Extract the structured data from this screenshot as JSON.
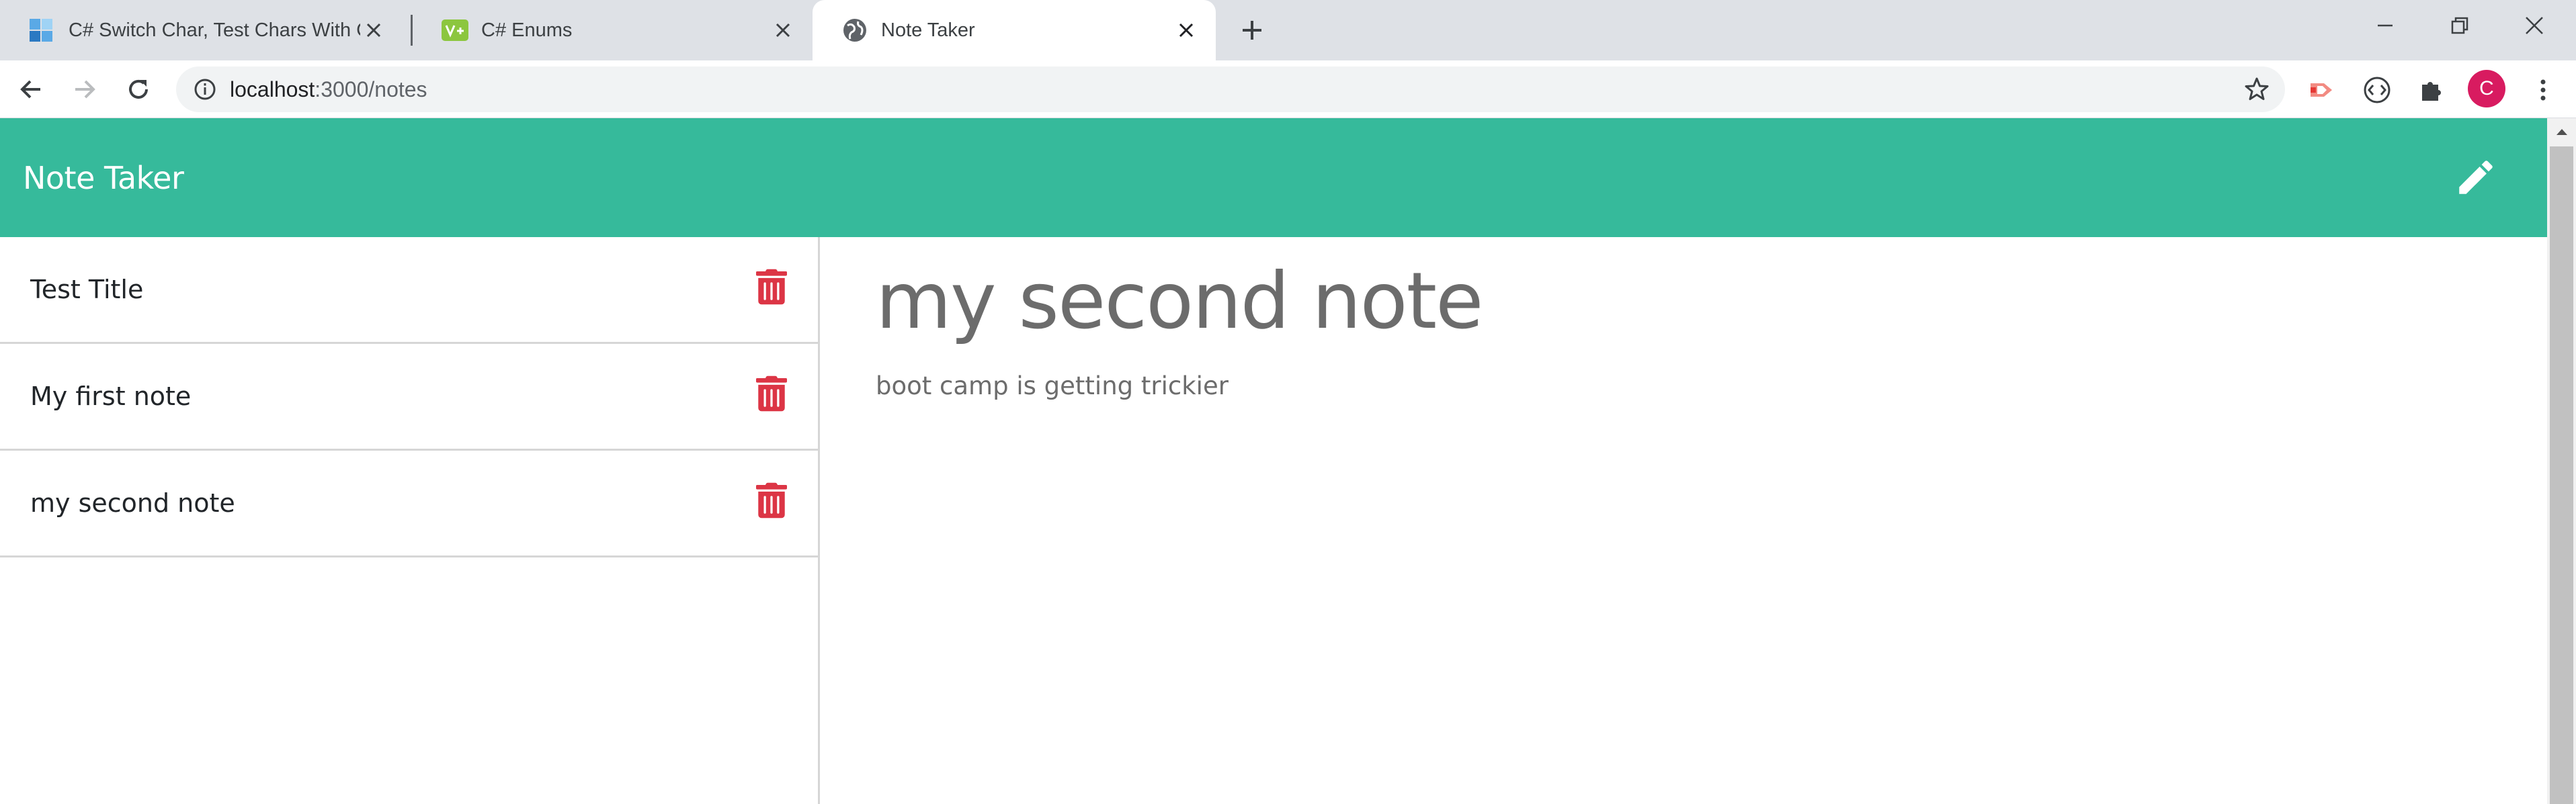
{
  "browser": {
    "tabs": [
      {
        "title": "C# Switch Char, Test Chars With Case",
        "active": false
      },
      {
        "title": "C# Enums",
        "active": false
      },
      {
        "title": "Note Taker",
        "active": true
      }
    ],
    "address": {
      "host": "localhost",
      "path": ":3000/notes"
    },
    "profile_initial": "C",
    "profile_color": "#d81b60"
  },
  "app": {
    "title": "Note Taker",
    "header_color": "#36ba9b",
    "delete_color": "#dc3545"
  },
  "notes": [
    {
      "title": "Test Title"
    },
    {
      "title": "My first note"
    },
    {
      "title": "my second note"
    }
  ],
  "active_note": {
    "title": "my second note",
    "text": "boot camp is getting trickier"
  }
}
